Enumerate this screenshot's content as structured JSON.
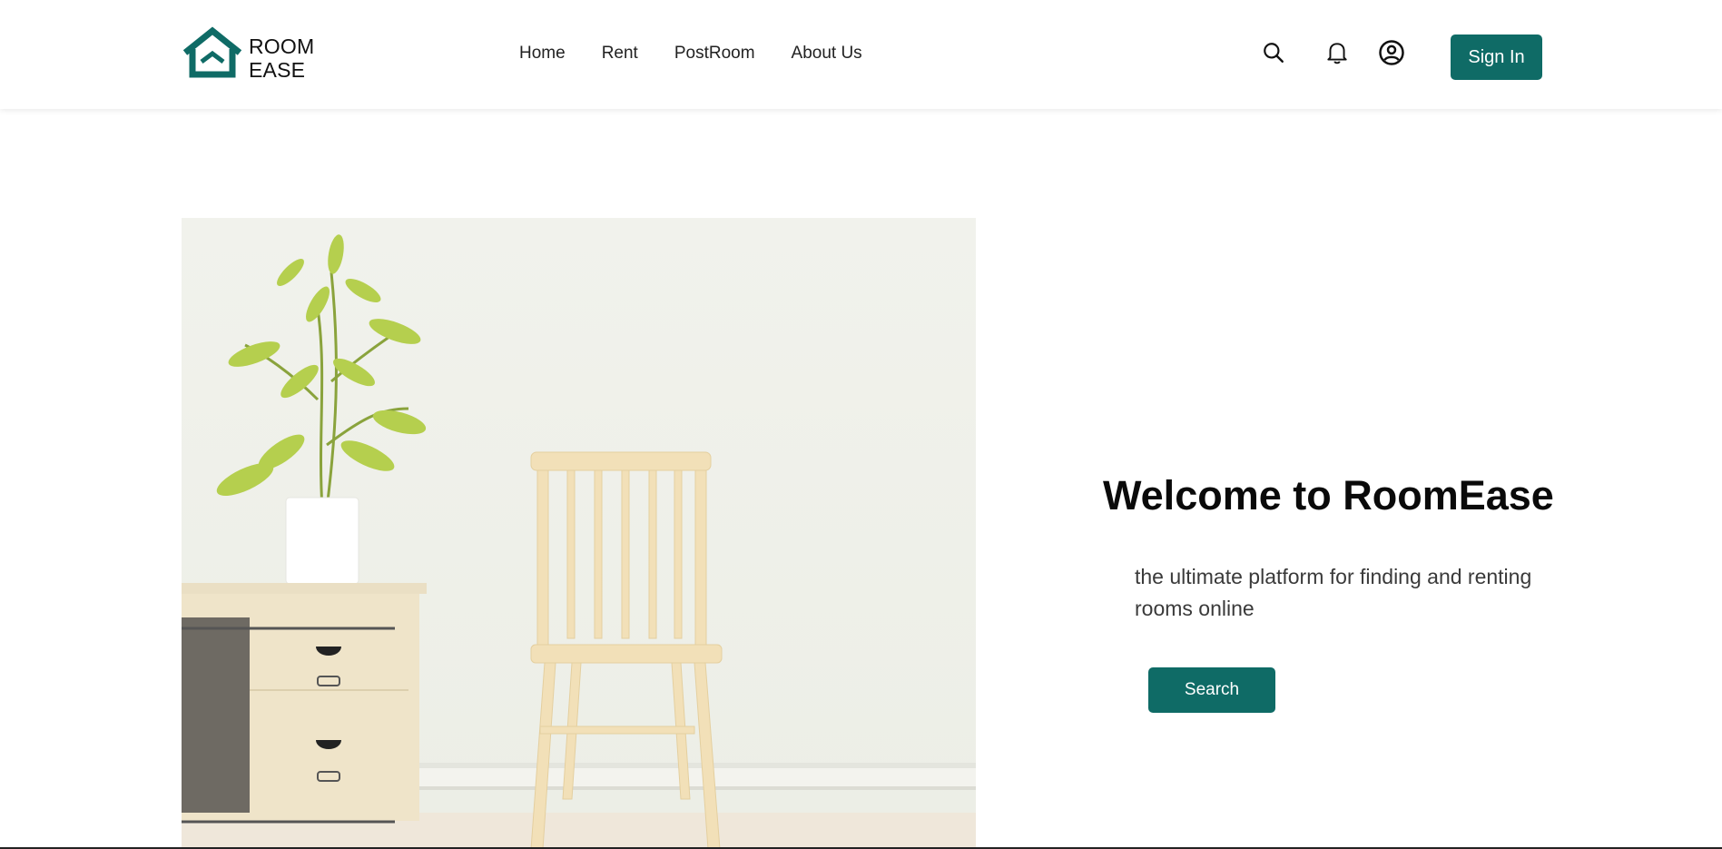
{
  "brand": {
    "line1": "ROOM",
    "line2": "EASE",
    "accent_color": "#0f6b66"
  },
  "nav": {
    "items": [
      {
        "label": "Home"
      },
      {
        "label": "Rent"
      },
      {
        "label": "PostRoom"
      },
      {
        "label": "About Us"
      }
    ]
  },
  "header_icons": [
    "search-icon",
    "bell-icon",
    "user-circle-icon"
  ],
  "header": {
    "signin_label": "Sign In"
  },
  "hero": {
    "title": "Welcome to RoomEase",
    "subtitle": "the ultimate platform for finding and renting rooms online",
    "search_label": "Search",
    "image_subject": "room-interior-photo"
  }
}
